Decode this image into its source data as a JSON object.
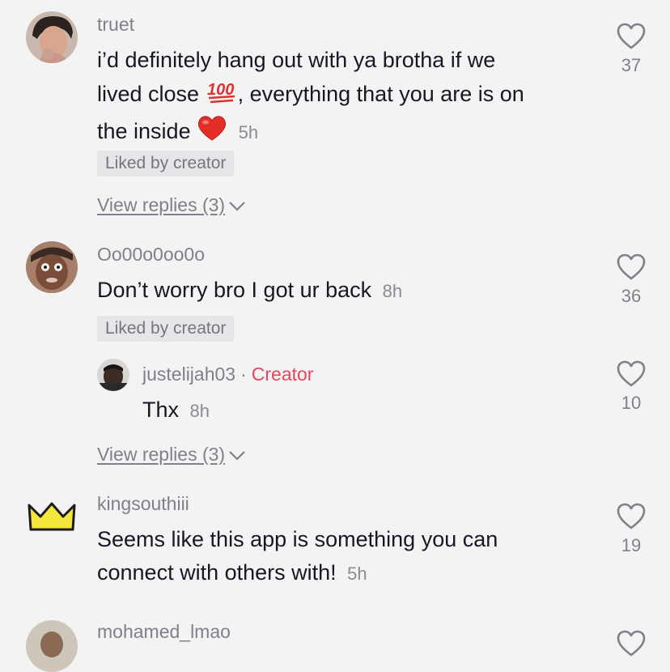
{
  "comments": [
    {
      "username": "truet",
      "text_line1": "i’d definitely hang out with ya brotha if we",
      "text_line2_a": "lived close",
      "text_line2_b": ", everything that you are is on",
      "text_line3": "the inside",
      "time": "5h",
      "liked_label": "Liked by creator",
      "view_replies": "View replies (3)",
      "likes": "37"
    },
    {
      "username": "Oo00o0oo0o",
      "text": "Don’t worry bro I got ur back",
      "time": "8h",
      "liked_label": "Liked by creator",
      "likes": "36",
      "reply": {
        "username": "justelijah03",
        "separator": "·",
        "badge": "Creator",
        "text": "Thx",
        "time": "8h",
        "likes": "10"
      },
      "view_replies": "View replies (3)"
    },
    {
      "username": "kingsouthiii",
      "text_line1": "Seems like this app is something you can",
      "text_line2": "connect with others with!",
      "time": "5h",
      "likes": "19"
    },
    {
      "username": "mohamed_lmao"
    }
  ],
  "colors": {
    "background": "#f3f3f4",
    "text": "#161823",
    "muted": "#7f8089",
    "creator_badge": "#e8455d",
    "crown": "#f4e73c"
  },
  "icons": [
    "heart-outline-icon",
    "chevron-down-icon",
    "crown-icon",
    "hundred-points-emoji",
    "red-heart-emoji"
  ]
}
